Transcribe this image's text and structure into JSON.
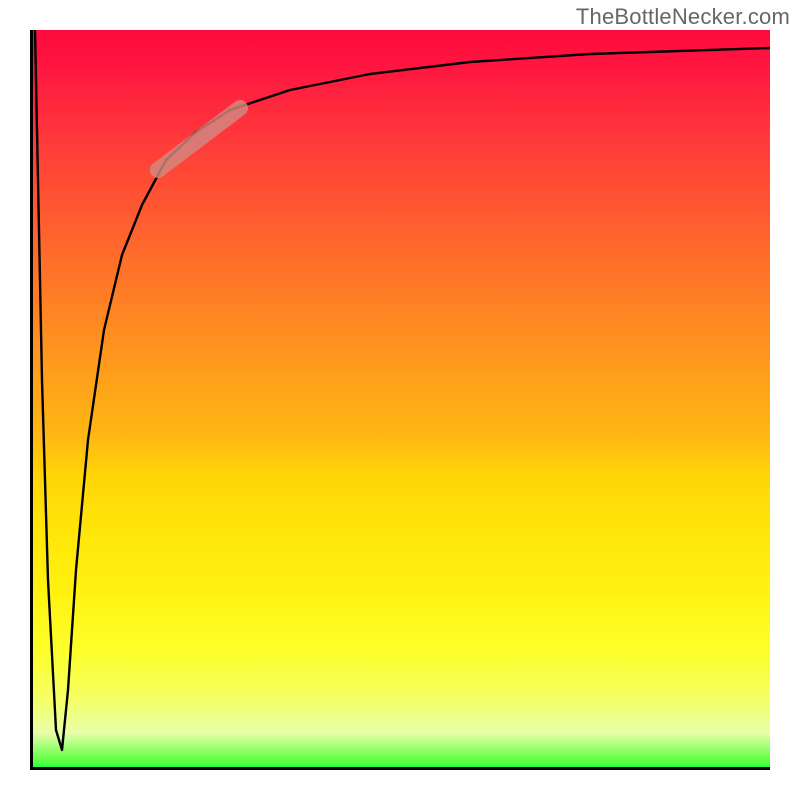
{
  "attribution": "TheBottleNecker.com",
  "colors": {
    "gradient_top": "#ff0a3c",
    "gradient_bottom": "#00ff50",
    "highlight_pill": "#d48981",
    "curve": "#000000",
    "axis": "#000000"
  },
  "chart_data": {
    "type": "line",
    "title": "",
    "xlabel": "",
    "ylabel": "",
    "xlim": [
      0,
      100
    ],
    "ylim": [
      0,
      100
    ],
    "x": [
      0,
      1,
      2,
      3,
      4,
      5,
      6,
      8,
      10,
      12,
      15,
      18,
      22,
      27,
      35,
      45,
      60,
      80,
      100
    ],
    "values": [
      100,
      70,
      40,
      15,
      2,
      15,
      40,
      60,
      70,
      76,
      82,
      85,
      88,
      90,
      92,
      94,
      95.5,
      96.5,
      97
    ],
    "annotations": [
      {
        "type": "highlight_segment",
        "x0": 18,
        "y0": 83,
        "x1": 30,
        "y1": 90
      }
    ],
    "background": "vertical_gradient_heat",
    "grid": false,
    "legend": false
  }
}
